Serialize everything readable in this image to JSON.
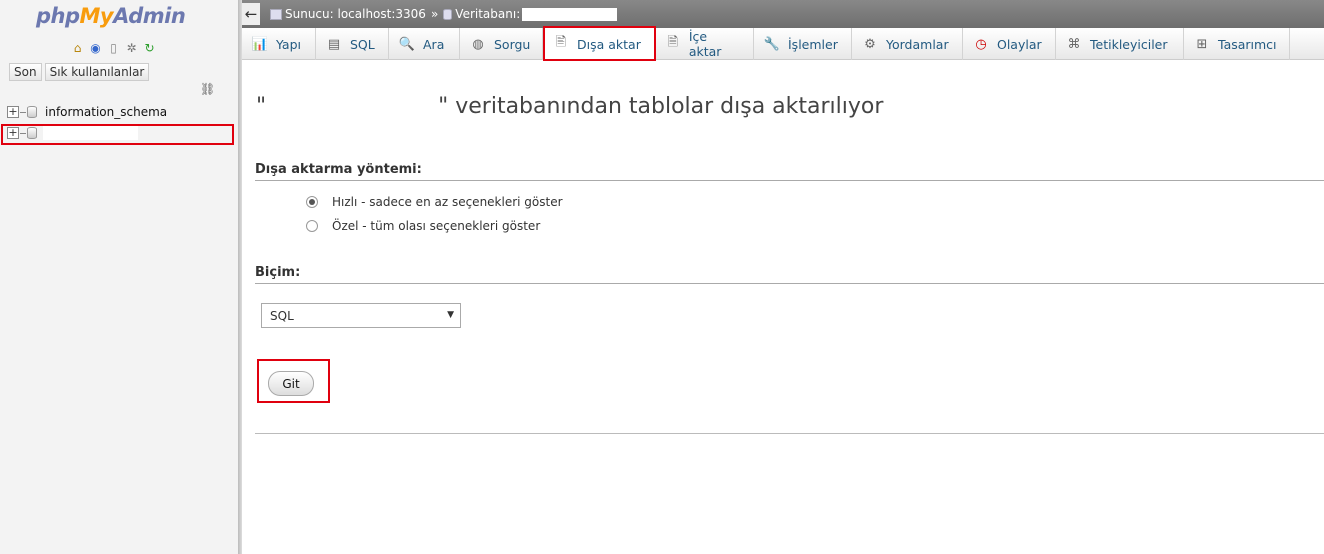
{
  "sidebar": {
    "logo": {
      "php": "php",
      "my": "My",
      "admin": "Admin"
    },
    "icons": [
      "home-icon",
      "help-icon",
      "docs-icon",
      "settings-icon",
      "reload-icon"
    ],
    "recent_label": "Son",
    "favorites_label": "Sık kullanılanlar",
    "databases": [
      {
        "name": "information_schema"
      },
      {
        "name": ""
      }
    ]
  },
  "topbar": {
    "server_label": "Sunucu: localhost:3306",
    "separator": "»",
    "database_label": "Veritabanı:"
  },
  "tabs": [
    {
      "label": "Yapı",
      "icon": "structure-icon"
    },
    {
      "label": "SQL",
      "icon": "sql-icon"
    },
    {
      "label": "Ara",
      "icon": "search-icon"
    },
    {
      "label": "Sorgu",
      "icon": "query-icon"
    },
    {
      "label": "Dışa aktar",
      "icon": "export-icon",
      "active": true
    },
    {
      "label": "İçe aktar",
      "icon": "import-icon"
    },
    {
      "label": "İşlemler",
      "icon": "wrench-icon"
    },
    {
      "label": "Yordamlar",
      "icon": "routines-icon"
    },
    {
      "label": "Olaylar",
      "icon": "clock-icon"
    },
    {
      "label": "Tetikleyiciler",
      "icon": "triggers-icon"
    },
    {
      "label": "Tasarımcı",
      "icon": "designer-icon"
    }
  ],
  "main": {
    "title_prefix": "\"",
    "title_suffix": "\" veritabanından tablolar dışa aktarılıyor",
    "method_heading": "Dışa aktarma yöntemi:",
    "method_options": [
      {
        "label": "Hızlı - sadece en az seçenekleri göster",
        "checked": true
      },
      {
        "label": "Özel - tüm olası seçenekleri göster",
        "checked": false
      }
    ],
    "format_heading": "Biçim:",
    "format_selected": "SQL",
    "submit_label": "Git"
  },
  "colors": {
    "highlight": "#e0000e",
    "link": "#235a81",
    "topbar": "#7a7a7a"
  }
}
